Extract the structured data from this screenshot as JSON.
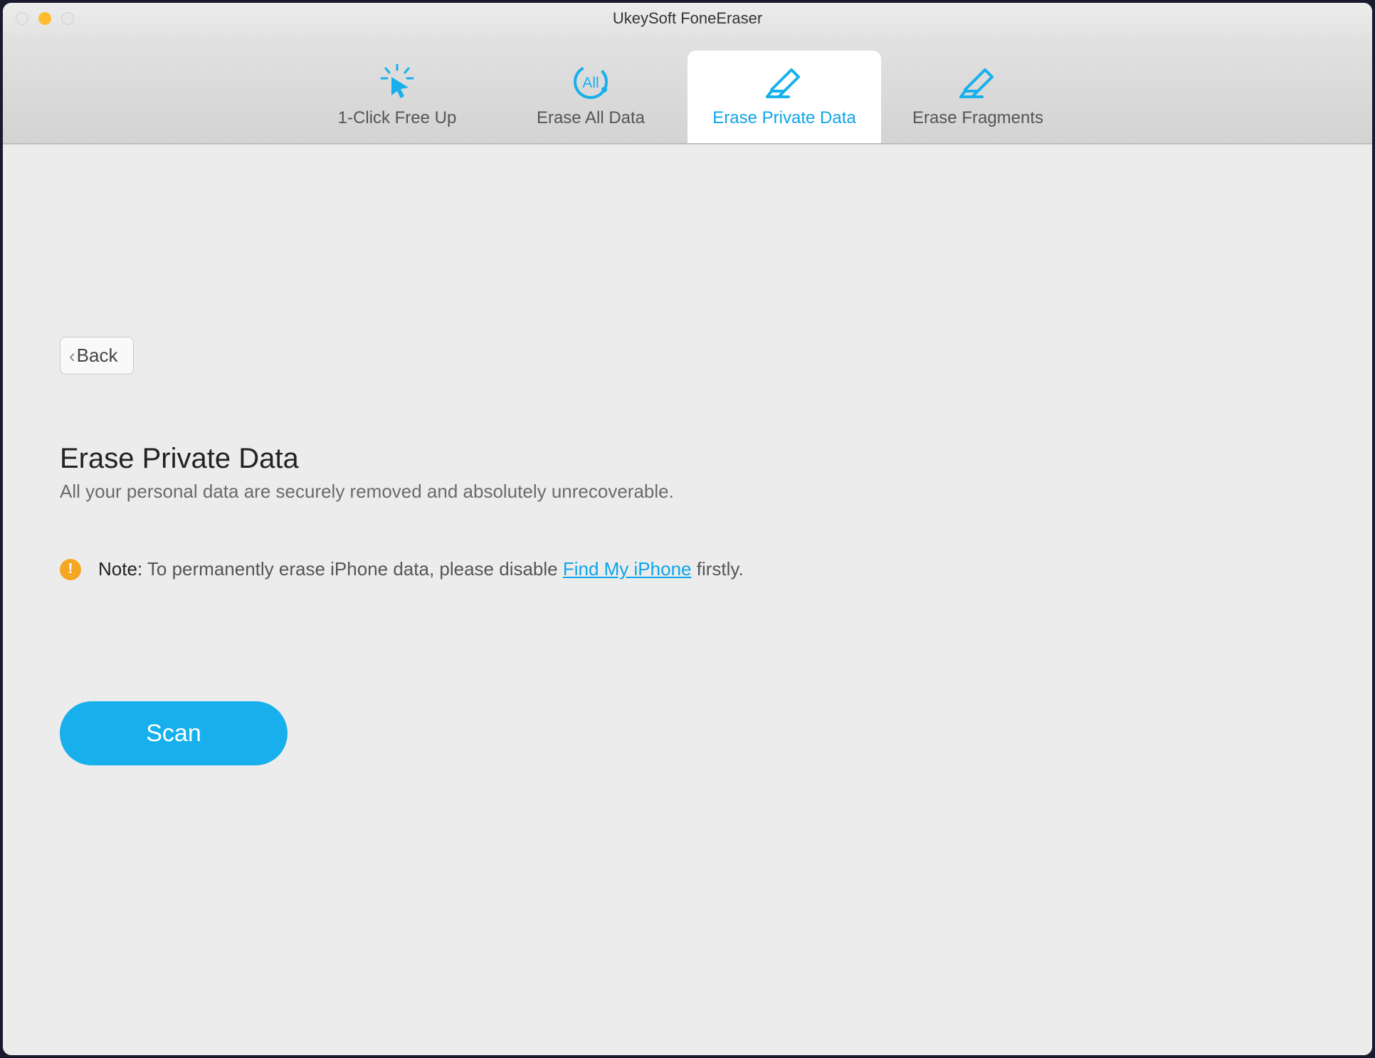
{
  "window": {
    "title": "UkeySoft FoneEraser"
  },
  "tabs": [
    {
      "label": "1-Click Free Up",
      "icon": "click-freeup-icon",
      "active": false
    },
    {
      "label": "Erase All Data",
      "icon": "erase-all-icon",
      "active": false
    },
    {
      "label": "Erase Private Data",
      "icon": "erase-private-icon",
      "active": true
    },
    {
      "label": "Erase Fragments",
      "icon": "erase-fragments-icon",
      "active": false
    }
  ],
  "back": {
    "label": "Back"
  },
  "page": {
    "heading": "Erase Private Data",
    "subtitle": "All your personal data are securely removed and absolutely unrecoverable."
  },
  "note": {
    "label": "Note:",
    "before_link": " To permanently erase iPhone data, please disable ",
    "link": "Find My iPhone",
    "after_link": " firstly."
  },
  "actions": {
    "scan": "Scan"
  },
  "colors": {
    "accent": "#17b0ec",
    "warning": "#f5a623"
  }
}
